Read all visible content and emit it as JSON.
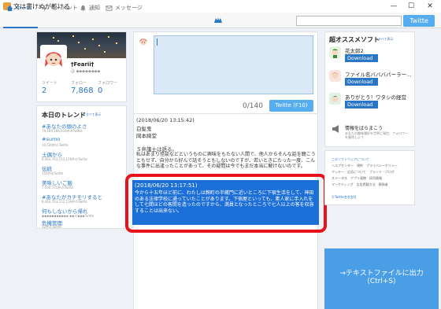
{
  "window": {
    "title": "文は書けぬが乾ける",
    "minimize": "—",
    "maximize": "☐",
    "close": "✕"
  },
  "nav": {
    "items": [
      {
        "label": "ホーム",
        "icon": "home-icon"
      },
      {
        "label": "モーメント",
        "icon": "lightning-icon"
      },
      {
        "label": "通知",
        "icon": "bell-icon"
      },
      {
        "label": "メッセージ",
        "icon": "envelope-icon"
      }
    ],
    "search_value": "",
    "twitte_button": "Twitte"
  },
  "profile": {
    "name": "†Fearii†",
    "handle": "@ ◆◆◆◆◆◆◆◆",
    "stats": [
      {
        "label": "ツイート",
        "value": "2"
      },
      {
        "label": "フォロー",
        "value": "7,868"
      },
      {
        "label": "フォロワー",
        "value": "0"
      }
    ]
  },
  "trends": {
    "title": "本日のトレンド",
    "change_link": "すべて表示",
    "items": [
      {
        "name": "#あなたの頭のよさ",
        "count": "79,189,186,916件のTwitte"
      },
      {
        "name": "#sumo",
        "count": "10,530件のTwitte"
      },
      {
        "name": "土偶から",
        "count": "8,463,763,152,156件のTwitte"
      },
      {
        "name": "伝統",
        "count": "156件のTwitte"
      },
      {
        "name": "美味しいご飯",
        "count": "7,506,725件のTwitte"
      },
      {
        "name": "#あなたがカチモリすると",
        "count": "8,463,763,152,156件のTwitte"
      },
      {
        "name": "何もしないから帰れ",
        "count": "◆◆◆◆◆◆◆◆◆◆◆ ◆◆の◆◆◆Twitte"
      },
      {
        "name": "危機管理",
        "count": "32件のTwitte"
      }
    ]
  },
  "composer": {
    "counter": "0/140",
    "button": "Twitte (F10)"
  },
  "timeline": {
    "tweet1": {
      "time": "(2018/06/20 13:15:42)",
      "line2": "白髪鬼",
      "line3": "岡本綺堂",
      "line4": "Ｓ弁護士は語る。",
      "body": "私はあまり怪談などというものに興味をもたない人間で、他人からそんな話を聴こうともせず、自分から好んで話そうともしないのですが、若いときにたった一度、こんな事件に出逢ったことがあって、その疑問は今でもまだ本当に解けないのです。"
    },
    "selected": {
      "time": "(2018/06/20 13:17:51)",
      "body": "今から十五年ほど前に、わたしは麹町の半蔵門に近いところに下宿生活をして、神田のある法律学校に通っていたことがあります。下宿屋といっても、素人家に手入れをして七間ほどの客間を造ったのですから、満員となったところで七人以上の客を収容することは出来ない。"
    }
  },
  "apps": {
    "title": "超オススメソフト",
    "more_link": "すべて表示",
    "items": [
      {
        "name": "花太郎2",
        "button": "Download",
        "icon_color": "#3a8c3a"
      },
      {
        "name": "ファイル名バババパーラー…",
        "button": "Download",
        "icon_color": "#d23b2b"
      },
      {
        "name": "ありがとう！ワタシの経営",
        "button": "Download",
        "icon_color": "#2f8a4f"
      }
    ],
    "info_title": "情報をばらまこう",
    "info_sub": "あなたの趣味嗜好を世界に発信、フォロワーを獲得しよう"
  },
  "footer": {
    "lines": [
      "このソフトウェアについて",
      "ヘルプセンター　規約　プライバシーポリシー",
      "クッキー　広告について　ブランド・ブログ",
      "ステータス　アプリ連携　採用情報",
      "マーケティング　広告掲載方法　開発者",
      "©Twitte合名会社"
    ]
  },
  "export": {
    "line1": "→テキストファイルに出力",
    "line2": "(Ctrl+S)"
  }
}
